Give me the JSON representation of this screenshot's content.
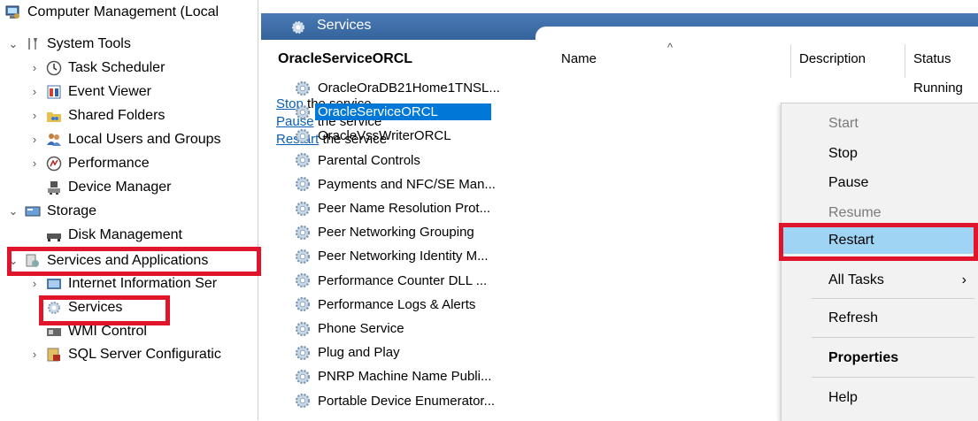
{
  "tree": {
    "root": "Computer Management (Local",
    "items": [
      {
        "label": "System Tools",
        "chev": "down",
        "icon": "tools-icon"
      },
      {
        "label": "Task Scheduler",
        "chev": "right",
        "icon": "clock-icon"
      },
      {
        "label": "Event Viewer",
        "chev": "right",
        "icon": "event-viewer-icon"
      },
      {
        "label": "Shared Folders",
        "chev": "right",
        "icon": "shared-folders-icon"
      },
      {
        "label": "Local Users and Groups",
        "chev": "right",
        "icon": "users-icon"
      },
      {
        "label": "Performance",
        "chev": "right",
        "icon": "performance-icon"
      },
      {
        "label": "Device Manager",
        "chev": "",
        "icon": "device-manager-icon"
      },
      {
        "label": "Storage",
        "chev": "down",
        "icon": "storage-icon"
      },
      {
        "label": "Disk Management",
        "chev": "",
        "icon": "disk-icon"
      },
      {
        "label": "Services and Applications",
        "chev": "down",
        "icon": "services-apps-icon"
      },
      {
        "label": "Internet Information Ser",
        "chev": "right",
        "icon": "iis-icon"
      },
      {
        "label": "Services",
        "chev": "",
        "icon": "services-icon"
      },
      {
        "label": "WMI Control",
        "chev": "",
        "icon": "wmi-icon"
      },
      {
        "label": "SQL Server Configuratic",
        "chev": "right",
        "icon": "sql-icon"
      }
    ]
  },
  "header": {
    "title": "Services"
  },
  "details": {
    "title": "OracleServiceORCL",
    "stop_link": "Stop",
    "stop_rest": " the service",
    "pause_link": "Pause",
    "pause_rest": " the service",
    "restart_link": "Restart",
    "restart_rest": " the service"
  },
  "columns": {
    "name": "Name",
    "description": "Description",
    "status": "Status",
    "sort_glyph": "^"
  },
  "services": [
    {
      "name": "OracleOraDB21Home1TNSL...",
      "status": "Running"
    },
    {
      "name": "OracleServiceORCL",
      "status": ""
    },
    {
      "name": "OracleVssWriterORCL",
      "status": ""
    },
    {
      "name": "Parental Controls",
      "status": ""
    },
    {
      "name": "Payments and NFC/SE Man...",
      "status": ""
    },
    {
      "name": "Peer Name Resolution Prot...",
      "status": ""
    },
    {
      "name": "Peer Networking Grouping",
      "status": ""
    },
    {
      "name": "Peer Networking Identity M...",
      "status": ""
    },
    {
      "name": "Performance Counter DLL ...",
      "status": ""
    },
    {
      "name": "Performance Logs & Alerts",
      "status": ""
    },
    {
      "name": "Phone Service",
      "status": ""
    },
    {
      "name": "Plug and Play",
      "status": ""
    },
    {
      "name": "PNRP Machine Name Publi...",
      "status": ""
    },
    {
      "name": "Portable Device Enumerator...",
      "status": ""
    }
  ],
  "context_menu": {
    "start": "Start",
    "stop": "Stop",
    "pause": "Pause",
    "resume": "Resume",
    "restart": "Restart",
    "all_tasks": "All Tasks",
    "all_tasks_arrow": "›",
    "refresh": "Refresh",
    "properties": "Properties",
    "help": "Help"
  },
  "colors": {
    "accent": "#0078d7",
    "highlight": "#9fd4f5",
    "annotation": "#e0142a",
    "header": "#3c6ea8"
  }
}
